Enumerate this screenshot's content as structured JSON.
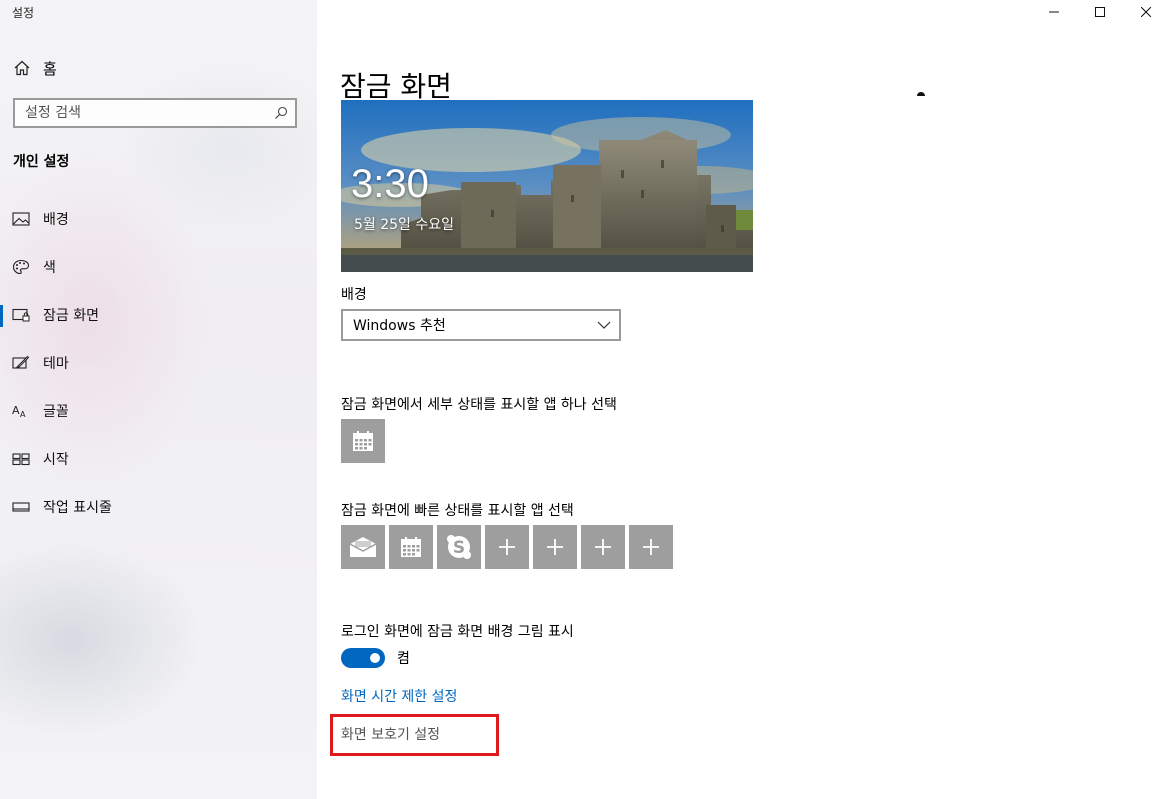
{
  "window": {
    "title": "설정"
  },
  "sidebar": {
    "home_label": "홈",
    "search_placeholder": "설정 검색",
    "section_title": "개인 설정",
    "items": [
      {
        "label": "배경",
        "icon": "picture-icon"
      },
      {
        "label": "색",
        "icon": "palette-icon"
      },
      {
        "label": "잠금 화면",
        "icon": "lock-screen-icon",
        "active": true
      },
      {
        "label": "테마",
        "icon": "theme-brush-icon"
      },
      {
        "label": "글꼴",
        "icon": "font-icon"
      },
      {
        "label": "시작",
        "icon": "start-icon"
      },
      {
        "label": "작업 표시줄",
        "icon": "taskbar-icon"
      }
    ]
  },
  "main": {
    "title": "잠금 화면",
    "preview": {
      "time": "3:30",
      "date": "5월 25일 수요일"
    },
    "background_label": "배경",
    "background_value": "Windows 추천",
    "detail_status_label": "잠금 화면에서 세부 상태를 표시할 앱 하나 선택",
    "quick_status_label": "잠금 화면에 빠른 상태를 표시할 앱 선택",
    "quick_tiles": [
      "mail-icon",
      "calendar-icon",
      "skype-icon",
      "plus-icon",
      "plus-icon",
      "plus-icon",
      "plus-icon"
    ],
    "signin_bg_label": "로그인 화면에 잠금 화면 배경 그림 표시",
    "signin_bg_toggle": {
      "on": true,
      "state_label": "켬"
    },
    "screen_timeout_link": "화면 시간 제한 설정",
    "screensaver_link": "화면 보호기 설정"
  },
  "colors": {
    "accent": "#0067c0",
    "highlight": "#e0191e",
    "tile": "#9e9e9e"
  }
}
